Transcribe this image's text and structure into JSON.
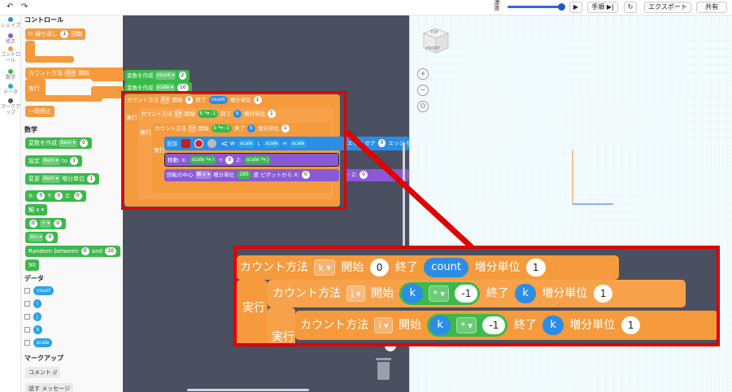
{
  "topbar": {
    "speed_label": "速度",
    "step_label": "手順",
    "export_label": "エクスポート",
    "share_label": "共有"
  },
  "categories": [
    {
      "label": "シェイプ",
      "color": "#2a8de6"
    },
    {
      "label": "修正",
      "color": "#8a5ad6"
    },
    {
      "label": "コントロール",
      "color": "#f59a3d"
    },
    {
      "label": "数学",
      "color": "#3cb94b"
    },
    {
      "label": "データ",
      "color": "#2aa3e6"
    },
    {
      "label": "マークアップ",
      "color": "#555555"
    }
  ],
  "palette": {
    "control_heading": "コントロール",
    "repeat_label": "繰り返し",
    "repeat_count": "1",
    "repeat_unit": "回数",
    "count_label": "カウント方法",
    "count_var": "m",
    "start_label": "開始",
    "start_value": "1",
    "end_label": "終了",
    "do_label": "実行",
    "pause_label": "一時停止",
    "math_heading": "数学",
    "create_var_label": "変数を作成",
    "create_var_name": "item",
    "create_var_value": "0",
    "set_label": "設定",
    "set_var": "item",
    "set_to": "to",
    "set_value": "1",
    "change_label": "変更",
    "change_var": "item",
    "change_step": "増分単位",
    "change_value": "1",
    "xyz_x": "0",
    "xyz_y": "0",
    "xyz_z": "0",
    "axis_label": "軸 x",
    "op_a": "0",
    "op_symbol": "+",
    "op_b": "0",
    "sin_label": "Sin",
    "sin_value": "0",
    "random_label": "Random between",
    "random_a": "0",
    "random_and": "and",
    "random_b": "10",
    "pi_label": "90",
    "data_heading": "データ",
    "vars": [
      "count",
      "i",
      "j",
      "k",
      "scale"
    ],
    "markup_heading": "マークアップ",
    "comment_label": "コメント //",
    "msg_label": "メッセージ",
    "msg_prefix": "話す"
  },
  "workspace": {
    "var1_label": "変数を作成",
    "var1_name": "count",
    "var1_value": "2",
    "var2_label": "変数を作成",
    "var2_name": "scale",
    "var2_value": "10",
    "loop1": {
      "label": "カウント方法",
      "var": "k",
      "start_label": "開始",
      "start": "0",
      "end_label": "終了",
      "end": "count",
      "step_label": "増分単位",
      "step": "1"
    },
    "loop2": {
      "label": "カウント方法",
      "var": "j",
      "start_label": "開始",
      "start_var": "k",
      "op": "*",
      "start_num": "-1",
      "end_label": "終了",
      "end": "k",
      "step_label": "増分単位",
      "step": "1"
    },
    "loop3": {
      "label": "カウント方法",
      "var": "i",
      "start_label": "開始",
      "start_var": "k",
      "op": "*",
      "start_num": "-1",
      "end_label": "終了",
      "end": "k",
      "step_label": "増分単位",
      "step": "1"
    },
    "do_label": "実行",
    "add_label": "追加",
    "w_label": "W",
    "l_label": "L",
    "h_label": "H",
    "scale_var": "scale",
    "edge_value": "0",
    "edge_label": "エッジ セグ",
    "move_label": "移動",
    "x_label": "X:",
    "y_label": "Y:",
    "z_label": "Z:",
    "move_i": "i",
    "move_y": "0",
    "move_j": "j",
    "rotate_label": "回転の中心",
    "rotate_axis": "軸 x",
    "rotate_step": "増分単位",
    "rotate_value": "180",
    "rotate_deg": "度",
    "pivot_label": "ピボットから",
    "pivot_x": "0",
    "pivot_z": "0"
  },
  "view3d": {
    "cube_top": "TOP",
    "cube_front": "FRONT",
    "zoom_in": "+",
    "zoom_out": "−",
    "fit": "⊙"
  },
  "zoom_callout": {
    "loop1": {
      "label": "カウント方法",
      "var": "k",
      "start_label": "開始",
      "start": "0",
      "end_label": "終了",
      "end": "count",
      "step_label": "増分単位",
      "step": "1"
    },
    "do_label": "実行",
    "loop2": {
      "label": "カウント方法",
      "var": "j",
      "start_label": "開始",
      "start_var": "k",
      "op": "*",
      "start_num": "-1",
      "end_label": "終了",
      "end": "k",
      "step_label": "増分単位",
      "step": "1"
    },
    "loop3": {
      "label": "カウント方法",
      "var": "i",
      "start_label": "開始",
      "start_var": "k",
      "op": "*",
      "start_num": "-1",
      "end_label": "終了",
      "end": "k",
      "step_label": "増分単位",
      "step": "1"
    }
  }
}
